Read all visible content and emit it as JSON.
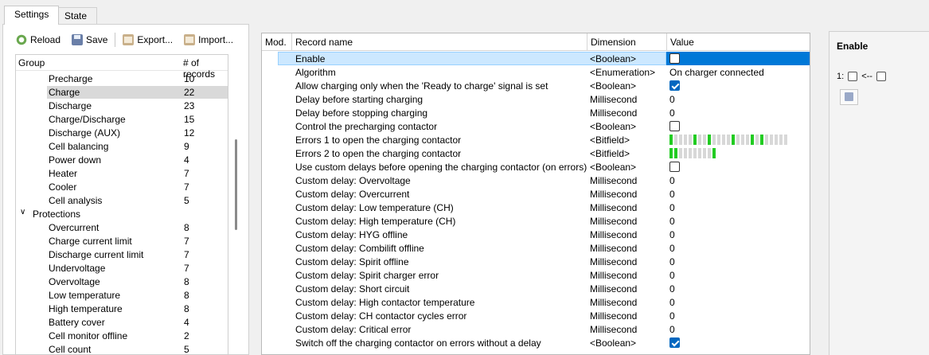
{
  "tabs": [
    {
      "label": "Settings",
      "active": true
    },
    {
      "label": "State",
      "active": false
    }
  ],
  "toolbar": {
    "reload": "Reload",
    "save": "Save",
    "export": "Export...",
    "import": "Import..."
  },
  "groups": {
    "col_group": "Group",
    "col_count": "# of records",
    "rows": [
      {
        "name": "Precharge",
        "count": "10"
      },
      {
        "name": "Charge",
        "count": "22",
        "selected": true
      },
      {
        "name": "Discharge",
        "count": "23"
      },
      {
        "name": "Charge/Discharge",
        "count": "15"
      },
      {
        "name": "Discharge (AUX)",
        "count": "12"
      },
      {
        "name": "Cell balancing",
        "count": "9"
      },
      {
        "name": "Power down",
        "count": "4"
      },
      {
        "name": "Heater",
        "count": "7"
      },
      {
        "name": "Cooler",
        "count": "7"
      },
      {
        "name": "Cell analysis",
        "count": "5"
      },
      {
        "name": "Protections",
        "count": "",
        "category": true
      },
      {
        "name": "Overcurrent",
        "count": "8"
      },
      {
        "name": "Charge current limit",
        "count": "7"
      },
      {
        "name": "Discharge current limit",
        "count": "7"
      },
      {
        "name": "Undervoltage",
        "count": "7"
      },
      {
        "name": "Overvoltage",
        "count": "8"
      },
      {
        "name": "Low temperature",
        "count": "8"
      },
      {
        "name": "High temperature",
        "count": "8"
      },
      {
        "name": "Battery cover",
        "count": "4"
      },
      {
        "name": "Cell monitor offline",
        "count": "2"
      },
      {
        "name": "Cell count",
        "count": "5"
      }
    ]
  },
  "records": {
    "col_mod": "Mod.",
    "col_name": "Record name",
    "col_dim": "Dimension",
    "col_value": "Value",
    "rows": [
      {
        "name": "Enable",
        "dim": "<Boolean>",
        "type": "bool",
        "value": false,
        "selected": true
      },
      {
        "name": "Algorithm",
        "dim": "<Enumeration>",
        "type": "text",
        "value": "On charger connected"
      },
      {
        "name": "Allow charging only when the 'Ready to charge' signal is set",
        "dim": "<Boolean>",
        "type": "bool",
        "value": true
      },
      {
        "name": "Delay before starting charging",
        "dim": "Millisecond",
        "type": "text",
        "value": "0"
      },
      {
        "name": "Delay before stopping charging",
        "dim": "Millisecond",
        "type": "text",
        "value": "0"
      },
      {
        "name": "Control the precharging contactor",
        "dim": "<Boolean>",
        "type": "bool",
        "value": false
      },
      {
        "name": "Errors 1 to open the charging contactor",
        "dim": "<Bitfield>",
        "type": "bits",
        "bits": [
          1,
          0,
          0,
          0,
          0,
          1,
          0,
          0,
          1,
          0,
          0,
          0,
          0,
          1,
          0,
          0,
          0,
          1,
          0,
          1,
          0,
          0,
          0,
          0,
          0,
          0,
          0,
          0,
          0,
          0,
          0,
          0,
          0,
          0,
          0,
          0,
          0,
          0,
          0,
          0,
          0,
          0,
          0,
          0,
          0,
          0,
          0,
          0,
          0,
          0,
          0,
          0,
          0,
          0,
          0,
          0,
          0,
          0,
          0,
          0,
          0,
          0
        ]
      },
      {
        "name": "Errors 2 to open the charging contactor",
        "dim": "<Bitfield>",
        "type": "bits",
        "bits": [
          1,
          1,
          0,
          0,
          0,
          0,
          0,
          0,
          0,
          1
        ]
      },
      {
        "name": "Use custom delays before opening the charging contactor (on errors)",
        "dim": "<Boolean>",
        "type": "bool",
        "value": false
      },
      {
        "name": "Custom delay: Overvoltage",
        "dim": "Millisecond",
        "type": "text",
        "value": "0"
      },
      {
        "name": "Custom delay: Overcurrent",
        "dim": "Millisecond",
        "type": "text",
        "value": "0"
      },
      {
        "name": "Custom delay: Low temperature (CH)",
        "dim": "Millisecond",
        "type": "text",
        "value": "0"
      },
      {
        "name": "Custom delay: High temperature (CH)",
        "dim": "Millisecond",
        "type": "text",
        "value": "0"
      },
      {
        "name": "Custom delay: HYG offline",
        "dim": "Millisecond",
        "type": "text",
        "value": "0"
      },
      {
        "name": "Custom delay: Combilift offline",
        "dim": "Millisecond",
        "type": "text",
        "value": "0"
      },
      {
        "name": "Custom delay: Spirit offline",
        "dim": "Millisecond",
        "type": "text",
        "value": "0"
      },
      {
        "name": "Custom delay: Spirit charger error",
        "dim": "Millisecond",
        "type": "text",
        "value": "0"
      },
      {
        "name": "Custom delay: Short circuit",
        "dim": "Millisecond",
        "type": "text",
        "value": "0"
      },
      {
        "name": "Custom delay: High contactor temperature",
        "dim": "Millisecond",
        "type": "text",
        "value": "0"
      },
      {
        "name": "Custom delay: CH contactor cycles error",
        "dim": "Millisecond",
        "type": "text",
        "value": "0"
      },
      {
        "name": "Custom delay: Critical error",
        "dim": "Millisecond",
        "type": "text",
        "value": "0"
      },
      {
        "name": "Switch off the charging contactor on errors without a delay",
        "dim": "<Boolean>",
        "type": "bool",
        "value": true
      }
    ]
  },
  "panel": {
    "title": "Enable",
    "row_label": "1:",
    "arrow": "<--"
  },
  "colors": {
    "selection": "#cce8ff",
    "value_selection": "#0078d7",
    "check_on": "#0067c0",
    "bit_on": "#22cc22"
  }
}
